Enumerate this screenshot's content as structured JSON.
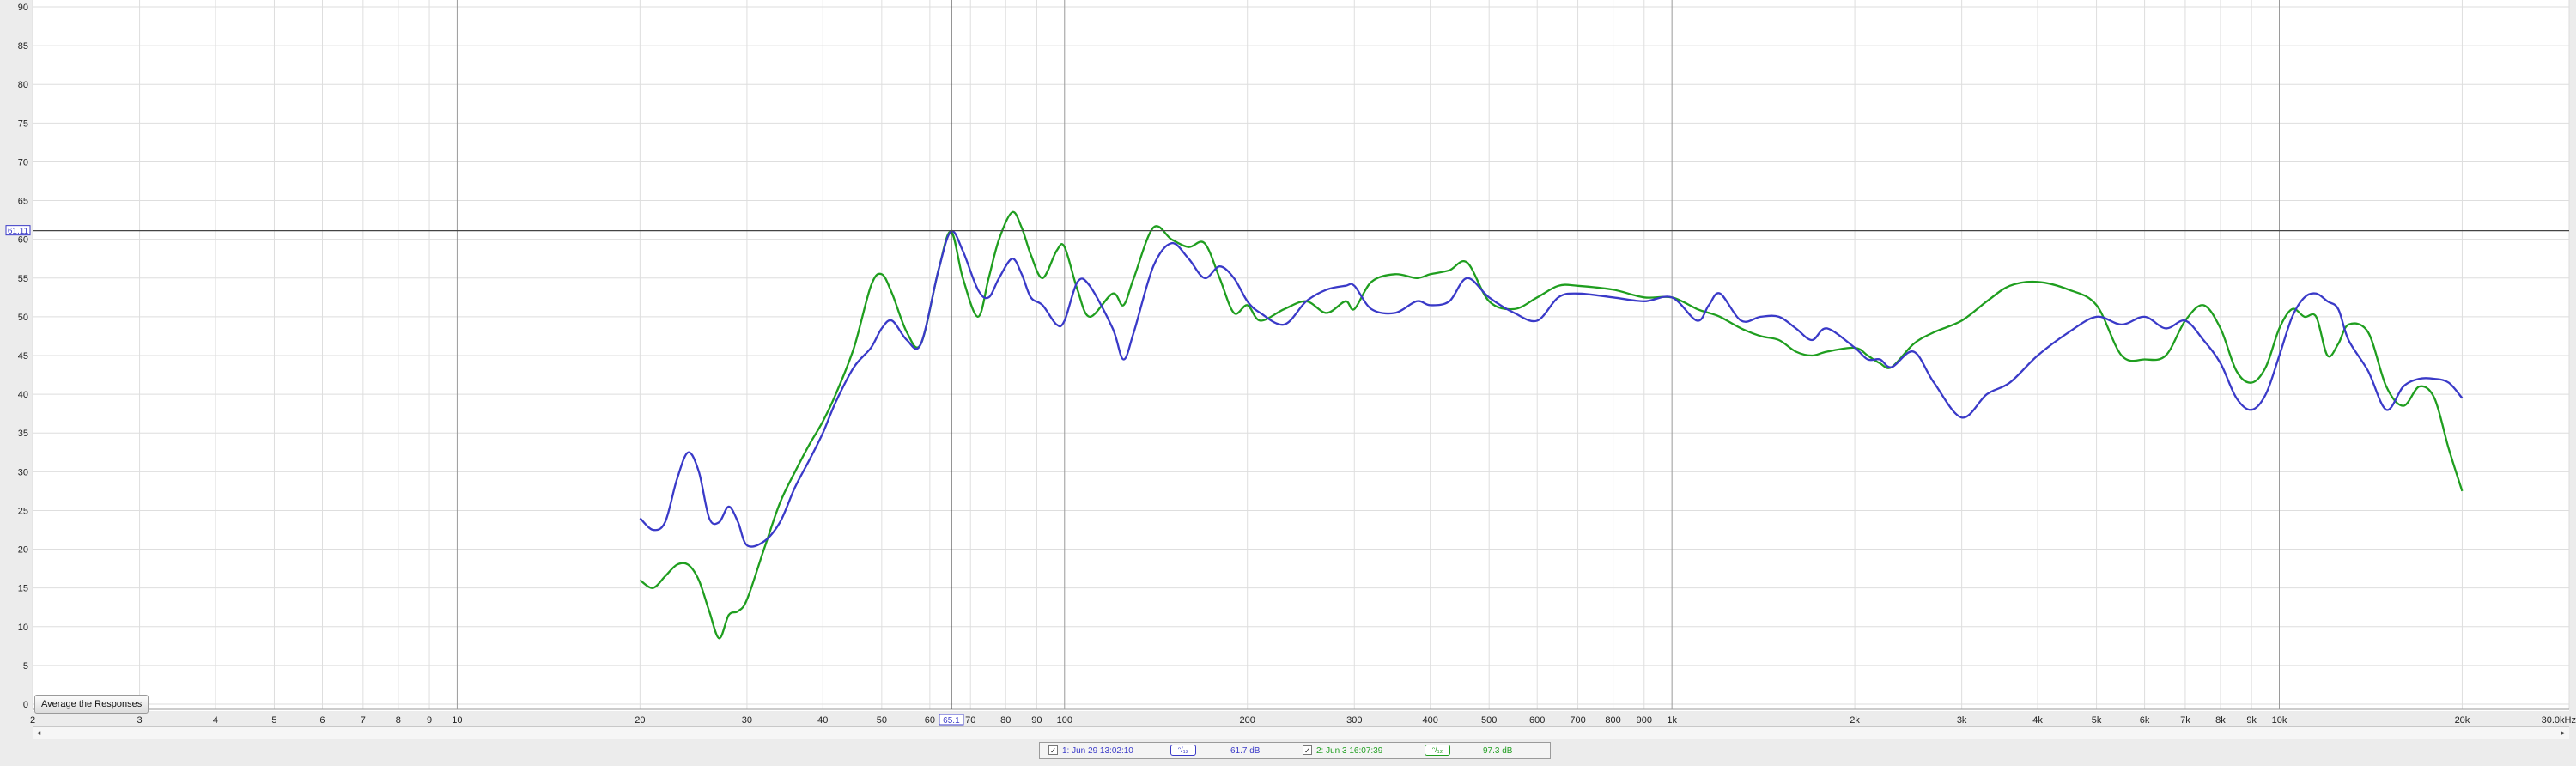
{
  "colors": {
    "plot_background": "#ffffff",
    "grid_minor": "#dedede",
    "grid_major": "#9a9a9a",
    "series_1": "#3a3ac8",
    "series_2": "#1f9e1f",
    "cursor": "#444444",
    "cursor_label": "#3a3ac8"
  },
  "cursor": {
    "x_label": "65.1",
    "y_label": "61.11"
  },
  "buttons": {
    "average": "Average the Responses"
  },
  "legend": {
    "items": [
      {
        "checkbox": "✓",
        "label": "1: Jun 29 13:02:10",
        "smoothing": "ᵔ/₁₂",
        "level": "61.7 dB",
        "color": "#3a3ac8"
      },
      {
        "checkbox": "✓",
        "label": "2: Jun 3 16:07:39",
        "smoothing": "ᵔ/₁₂",
        "level": "97.3 dB",
        "color": "#1f9e1f"
      }
    ]
  },
  "scrollbar": {
    "left_arrow": "◂",
    "right_arrow": "▸"
  },
  "chart_data": {
    "type": "line",
    "title": "",
    "xlabel": "",
    "ylabel": "",
    "x_scale": "log",
    "xlim": [
      2,
      30000
    ],
    "ylim": [
      0,
      90
    ],
    "grid": true,
    "legend_position": "bottom-center",
    "x_tick_labels": [
      {
        "value": 2,
        "label": "2"
      },
      {
        "value": 3,
        "label": "3"
      },
      {
        "value": 4,
        "label": "4"
      },
      {
        "value": 5,
        "label": "5"
      },
      {
        "value": 6,
        "label": "6"
      },
      {
        "value": 7,
        "label": "7"
      },
      {
        "value": 8,
        "label": "8"
      },
      {
        "value": 9,
        "label": "9"
      },
      {
        "value": 10,
        "label": "10"
      },
      {
        "value": 20,
        "label": "20"
      },
      {
        "value": 30,
        "label": "30"
      },
      {
        "value": 40,
        "label": "40"
      },
      {
        "value": 50,
        "label": "50"
      },
      {
        "value": 60,
        "label": "60"
      },
      {
        "value": 70,
        "label": "70"
      },
      {
        "value": 80,
        "label": "80"
      },
      {
        "value": 90,
        "label": "90"
      },
      {
        "value": 100,
        "label": "100"
      },
      {
        "value": 200,
        "label": "200"
      },
      {
        "value": 300,
        "label": "300"
      },
      {
        "value": 400,
        "label": "400"
      },
      {
        "value": 500,
        "label": "500"
      },
      {
        "value": 600,
        "label": "600"
      },
      {
        "value": 700,
        "label": "700"
      },
      {
        "value": 800,
        "label": "800"
      },
      {
        "value": 900,
        "label": "900"
      },
      {
        "value": 1000,
        "label": "1k"
      },
      {
        "value": 2000,
        "label": "2k"
      },
      {
        "value": 3000,
        "label": "3k"
      },
      {
        "value": 4000,
        "label": "4k"
      },
      {
        "value": 5000,
        "label": "5k"
      },
      {
        "value": 6000,
        "label": "6k"
      },
      {
        "value": 7000,
        "label": "7k"
      },
      {
        "value": 8000,
        "label": "8k"
      },
      {
        "value": 9000,
        "label": "9k"
      },
      {
        "value": 10000,
        "label": "10k"
      },
      {
        "value": 20000,
        "label": "20k"
      },
      {
        "value": 30000,
        "label": "30.0kHz"
      }
    ],
    "y_ticks": [
      0,
      5,
      10,
      15,
      20,
      25,
      30,
      35,
      40,
      45,
      50,
      55,
      60,
      65,
      70,
      75,
      80,
      85,
      90
    ],
    "series": [
      {
        "color": "#3a3ac8",
        "x": [
          20,
          21,
          22,
          23,
          24,
          25,
          26,
          27,
          28,
          29,
          30,
          32,
          34,
          36,
          38,
          40,
          42,
          45,
          48,
          50,
          52,
          55,
          58,
          62,
          65,
          68,
          72,
          75,
          78,
          82,
          85,
          88,
          92,
          97,
          100,
          105,
          110,
          120,
          125,
          130,
          140,
          150,
          160,
          170,
          180,
          190,
          200,
          210,
          230,
          250,
          270,
          290,
          300,
          320,
          350,
          380,
          400,
          430,
          460,
          500,
          550,
          600,
          650,
          700,
          800,
          900,
          1000,
          1100,
          1150,
          1200,
          1300,
          1400,
          1500,
          1600,
          1700,
          1800,
          2000,
          2100,
          2200,
          2300,
          2500,
          2700,
          3000,
          3300,
          3600,
          4000,
          4500,
          5000,
          5500,
          6000,
          6500,
          7000,
          7500,
          8000,
          8500,
          9000,
          9500,
          10000,
          10500,
          11000,
          11500,
          12000,
          12500,
          13000,
          14000,
          15000,
          16000,
          17000,
          18000,
          19000,
          20000
        ],
        "values": [
          24,
          22.5,
          23.5,
          29,
          32.5,
          30,
          24,
          23.5,
          25.5,
          23.5,
          20.5,
          21,
          23.5,
          28,
          31.5,
          35,
          39,
          43.5,
          46,
          48.5,
          49.5,
          47,
          46.5,
          56,
          61,
          58.5,
          53.5,
          52.5,
          55,
          57.5,
          55.5,
          52.5,
          51.5,
          49,
          49.5,
          54.5,
          54,
          48.5,
          44.5,
          48,
          56.5,
          59.5,
          57.5,
          55,
          56.5,
          55,
          52,
          50.5,
          49,
          52,
          53.5,
          54,
          54,
          51,
          50.5,
          52,
          51.5,
          52,
          55,
          52.5,
          50.5,
          49.5,
          52.5,
          53,
          52.5,
          52,
          52.5,
          49.5,
          51.5,
          53,
          49.5,
          50,
          50,
          48.5,
          47,
          48.5,
          46,
          44.5,
          44.5,
          43.5,
          45.5,
          41.5,
          37,
          40,
          41.5,
          45,
          48,
          50,
          49,
          50,
          48.5,
          49.5,
          47,
          44,
          39.5,
          38,
          40,
          45,
          50,
          52.5,
          53,
          52,
          51,
          47,
          43,
          38,
          41,
          42,
          42,
          41.5,
          39.5
        ]
      },
      {
        "color": "#1f9e1f",
        "x": [
          20,
          21,
          22,
          23,
          24,
          25,
          26,
          27,
          28,
          29,
          30,
          32,
          34,
          36,
          38,
          40,
          42,
          45,
          48,
          50,
          52,
          55,
          58,
          62,
          65,
          68,
          72,
          75,
          78,
          82,
          85,
          88,
          92,
          97,
          100,
          105,
          110,
          120,
          125,
          130,
          140,
          150,
          160,
          170,
          180,
          190,
          200,
          210,
          230,
          250,
          270,
          290,
          300,
          320,
          350,
          380,
          400,
          430,
          460,
          500,
          550,
          600,
          650,
          700,
          800,
          900,
          1000,
          1100,
          1150,
          1200,
          1300,
          1400,
          1500,
          1600,
          1700,
          1800,
          2000,
          2100,
          2200,
          2300,
          2500,
          2700,
          3000,
          3300,
          3600,
          4000,
          4500,
          5000,
          5500,
          6000,
          6500,
          7000,
          7500,
          8000,
          8500,
          9000,
          9500,
          10000,
          10500,
          11000,
          11500,
          12000,
          12500,
          13000,
          14000,
          15000,
          16000,
          17000,
          18000,
          19000,
          20000
        ],
        "values": [
          16,
          15,
          16.5,
          18,
          18,
          16,
          12,
          8.5,
          11.5,
          12,
          13.5,
          20,
          26,
          30,
          33.5,
          36.5,
          40,
          46,
          54,
          55.5,
          53,
          48,
          46.5,
          56,
          61,
          55,
          50,
          55,
          60,
          63.5,
          61.5,
          58,
          55,
          58.5,
          59,
          53.5,
          50,
          53,
          51.5,
          55,
          61.5,
          60,
          59,
          59.5,
          55,
          50.5,
          51.5,
          49.5,
          51,
          52,
          50.5,
          52,
          51,
          54.5,
          55.5,
          55,
          55.5,
          56,
          57,
          52,
          51,
          52.5,
          54,
          54,
          53.5,
          52.5,
          52.5,
          51,
          50.5,
          50,
          48.5,
          47.5,
          47,
          45.5,
          45,
          45.5,
          46,
          45,
          44,
          43.5,
          46.5,
          48,
          49.5,
          52,
          54,
          54.5,
          53.5,
          51.5,
          45,
          44.5,
          45,
          49.5,
          51.5,
          48.5,
          43,
          41.5,
          43.5,
          48.5,
          51,
          50,
          50,
          45,
          46.5,
          49,
          48,
          41,
          38.5,
          41,
          39.5,
          33,
          27.5
        ]
      }
    ]
  }
}
